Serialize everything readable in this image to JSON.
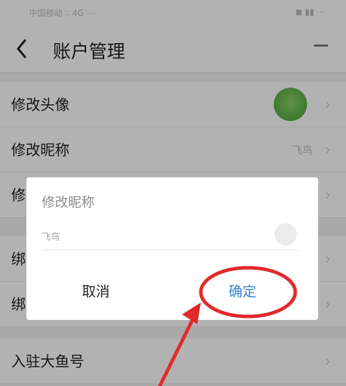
{
  "status_bar": {
    "left": "中国移动 ∶∶ 4G ⋯",
    "right": "◼ ▮▮ ⋯"
  },
  "header": {
    "title": "账户管理"
  },
  "rows": [
    {
      "label": "修改头像"
    },
    {
      "label": "修改昵称",
      "value": "飞鸟"
    },
    {
      "label": "修"
    },
    {
      "label": "绑"
    },
    {
      "label": "绑"
    },
    {
      "label": "入驻大鱼号"
    }
  ],
  "dialog": {
    "title": "修改昵称",
    "input_value": "飞鸟",
    "cancel_label": "取消",
    "confirm_label": "确定"
  },
  "colors": {
    "confirm": "#3b86cc",
    "annotation": "#e12a2a",
    "avatar": "#5cb543"
  }
}
